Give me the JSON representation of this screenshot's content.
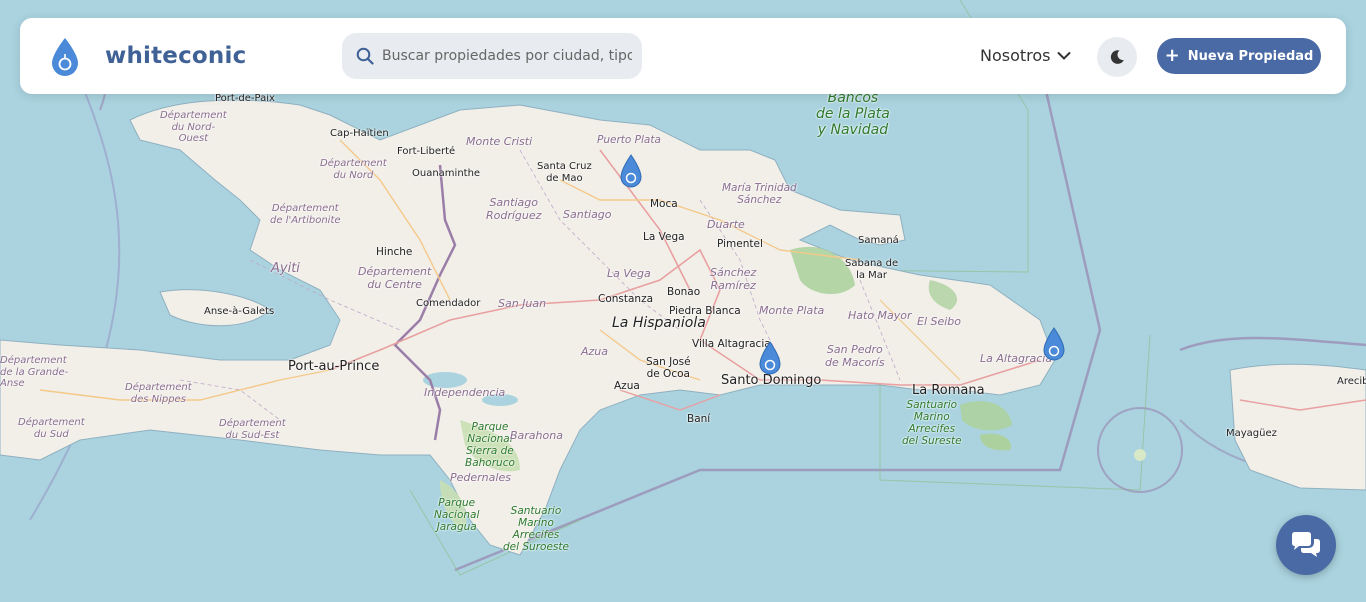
{
  "brand": {
    "name": "whiteconic",
    "accent": "#3f6196"
  },
  "search": {
    "placeholder": "Buscar propiedades por ciudad, tipo"
  },
  "nav": {
    "about_label": "Nosotros"
  },
  "actions": {
    "new_property_label": "Nueva Propiedad",
    "button_color": "#4a6aa5"
  },
  "icons": {
    "search": "search-icon",
    "theme": "moon-icon",
    "chat": "chat-icon",
    "chevron": "chevron-down-icon",
    "marker": "water-drop-pin-icon"
  },
  "map": {
    "colors": {
      "water": "#aad3df",
      "land": "#f2efe9",
      "forest": "#add19e"
    },
    "labels": {
      "port_de_paix": "Port-de-Paix",
      "nord_ouest": "Département\ndu Nord-\nOuest",
      "cap_haitien": "Cap-Haïtien",
      "fort_liberte": "Fort-Liberté",
      "monte_cristi": "Monte Cristi",
      "puerto_plata": "Puerto Plata",
      "dept_nord": "Département\ndu Nord",
      "ouanaminthe": "Ouanaminthe",
      "santa_cruz_mao": "Santa Cruz\nde Mao",
      "bancos_plata": "Bancos\nde la Plata\ny Navidad",
      "maria_trinidad": "María Trinidad\nSánchez",
      "artibonite": "Département\nde l'Artibonite",
      "santiago_rodriguez": "Santiago\nRodríguez",
      "santiago": "Santiago",
      "moca": "Moca",
      "duarte": "Duarte",
      "samana": "Samaná",
      "la_vega_city": "La Vega",
      "pimentel": "Pimentel",
      "hinche": "Hinche",
      "ayiti": "Ayiti",
      "dept_centre": "Département\ndu Centre",
      "la_vega_prov": "La Vega",
      "sanchez_ramirez": "Sánchez\nRamírez",
      "sabana_mar": "Sabana de\nla Mar",
      "comendador": "Comendador",
      "san_juan": "San Juan",
      "bonao": "Bonao",
      "constanza": "Constanza",
      "anse_a_galets": "Anse-à-Galets",
      "piedra_blanca": "Piedra Blanca",
      "monte_plata": "Monte Plata",
      "hato_mayor": "Hato Mayor",
      "el_seibo": "El Seibo",
      "la_hispaniola": "La Hispaniola",
      "azua_prov": "Azua",
      "villa_altagracia": "Villa Altagracia",
      "san_pedro": "San Pedro\nde Macorís",
      "la_altagracia": "La Altagracia",
      "port_au_prince": "Port-au-Prince",
      "san_jose_ocoa": "San José\nde Ocoa",
      "santo_domingo": "Santo Domingo",
      "grande_anse": "Département\nde la Grande-\nAnse",
      "nippes": "Département\ndes Nippes",
      "azua_city": "Azua",
      "la_romana": "La Romana",
      "independencia": "Independencia",
      "santuario_sureste": "Santuario\nMarino\nArrecifes\ndel Sureste",
      "bani": "Baní",
      "dept_sud": "Département\ndu Sud",
      "dept_sud_est": "Département\ndu Sud-Est",
      "parque_bahoruco": "Parque\nNacional\nSierra de\nBahoruco",
      "barahona": "Barahona",
      "pedernales": "Pedernales",
      "mayaguez": "Mayagüez",
      "arecibo": "Arecib",
      "parque_jaragua": "Parque\nNacional\nJaragua",
      "santuario_suroeste": "Santuario\nMarino\nArrecifes\ndel Suroeste"
    }
  }
}
